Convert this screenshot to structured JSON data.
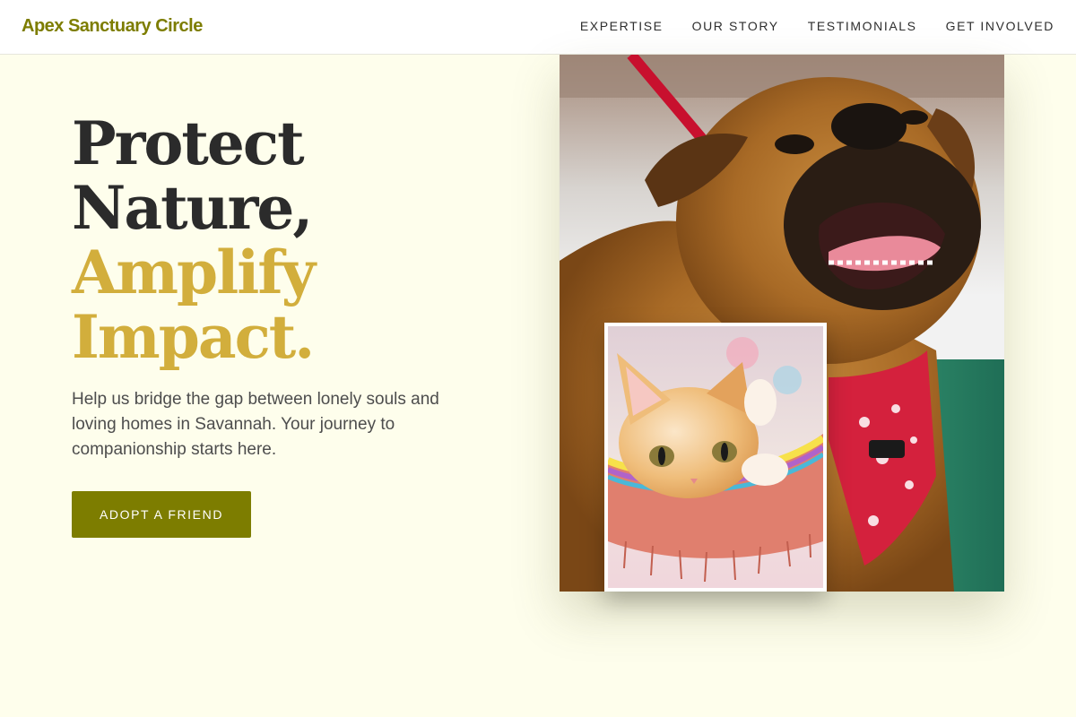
{
  "header": {
    "brand": "Apex Sanctuary Circle",
    "nav": [
      "EXPERTISE",
      "OUR STORY",
      "TESTIMONIALS",
      "GET INVOLVED"
    ]
  },
  "hero": {
    "title_line1": "Protect",
    "title_line2": "Nature,",
    "title_line3": "Amplify",
    "title_line4": "Impact.",
    "subtitle": "Help us bridge the gap between lonely souls and loving homes in Savannah. Your journey to companionship starts here.",
    "cta_label": "ADOPT A FRIEND"
  },
  "images": {
    "main_alt": "Happy dog wearing a red bandana",
    "inset_alt": "Orange kitten in a colorful woven hammock"
  },
  "colors": {
    "brand": "#7d7d00",
    "accent_gold": "#d2ae3c",
    "background": "#fefeec",
    "button": "#7d7d00"
  }
}
